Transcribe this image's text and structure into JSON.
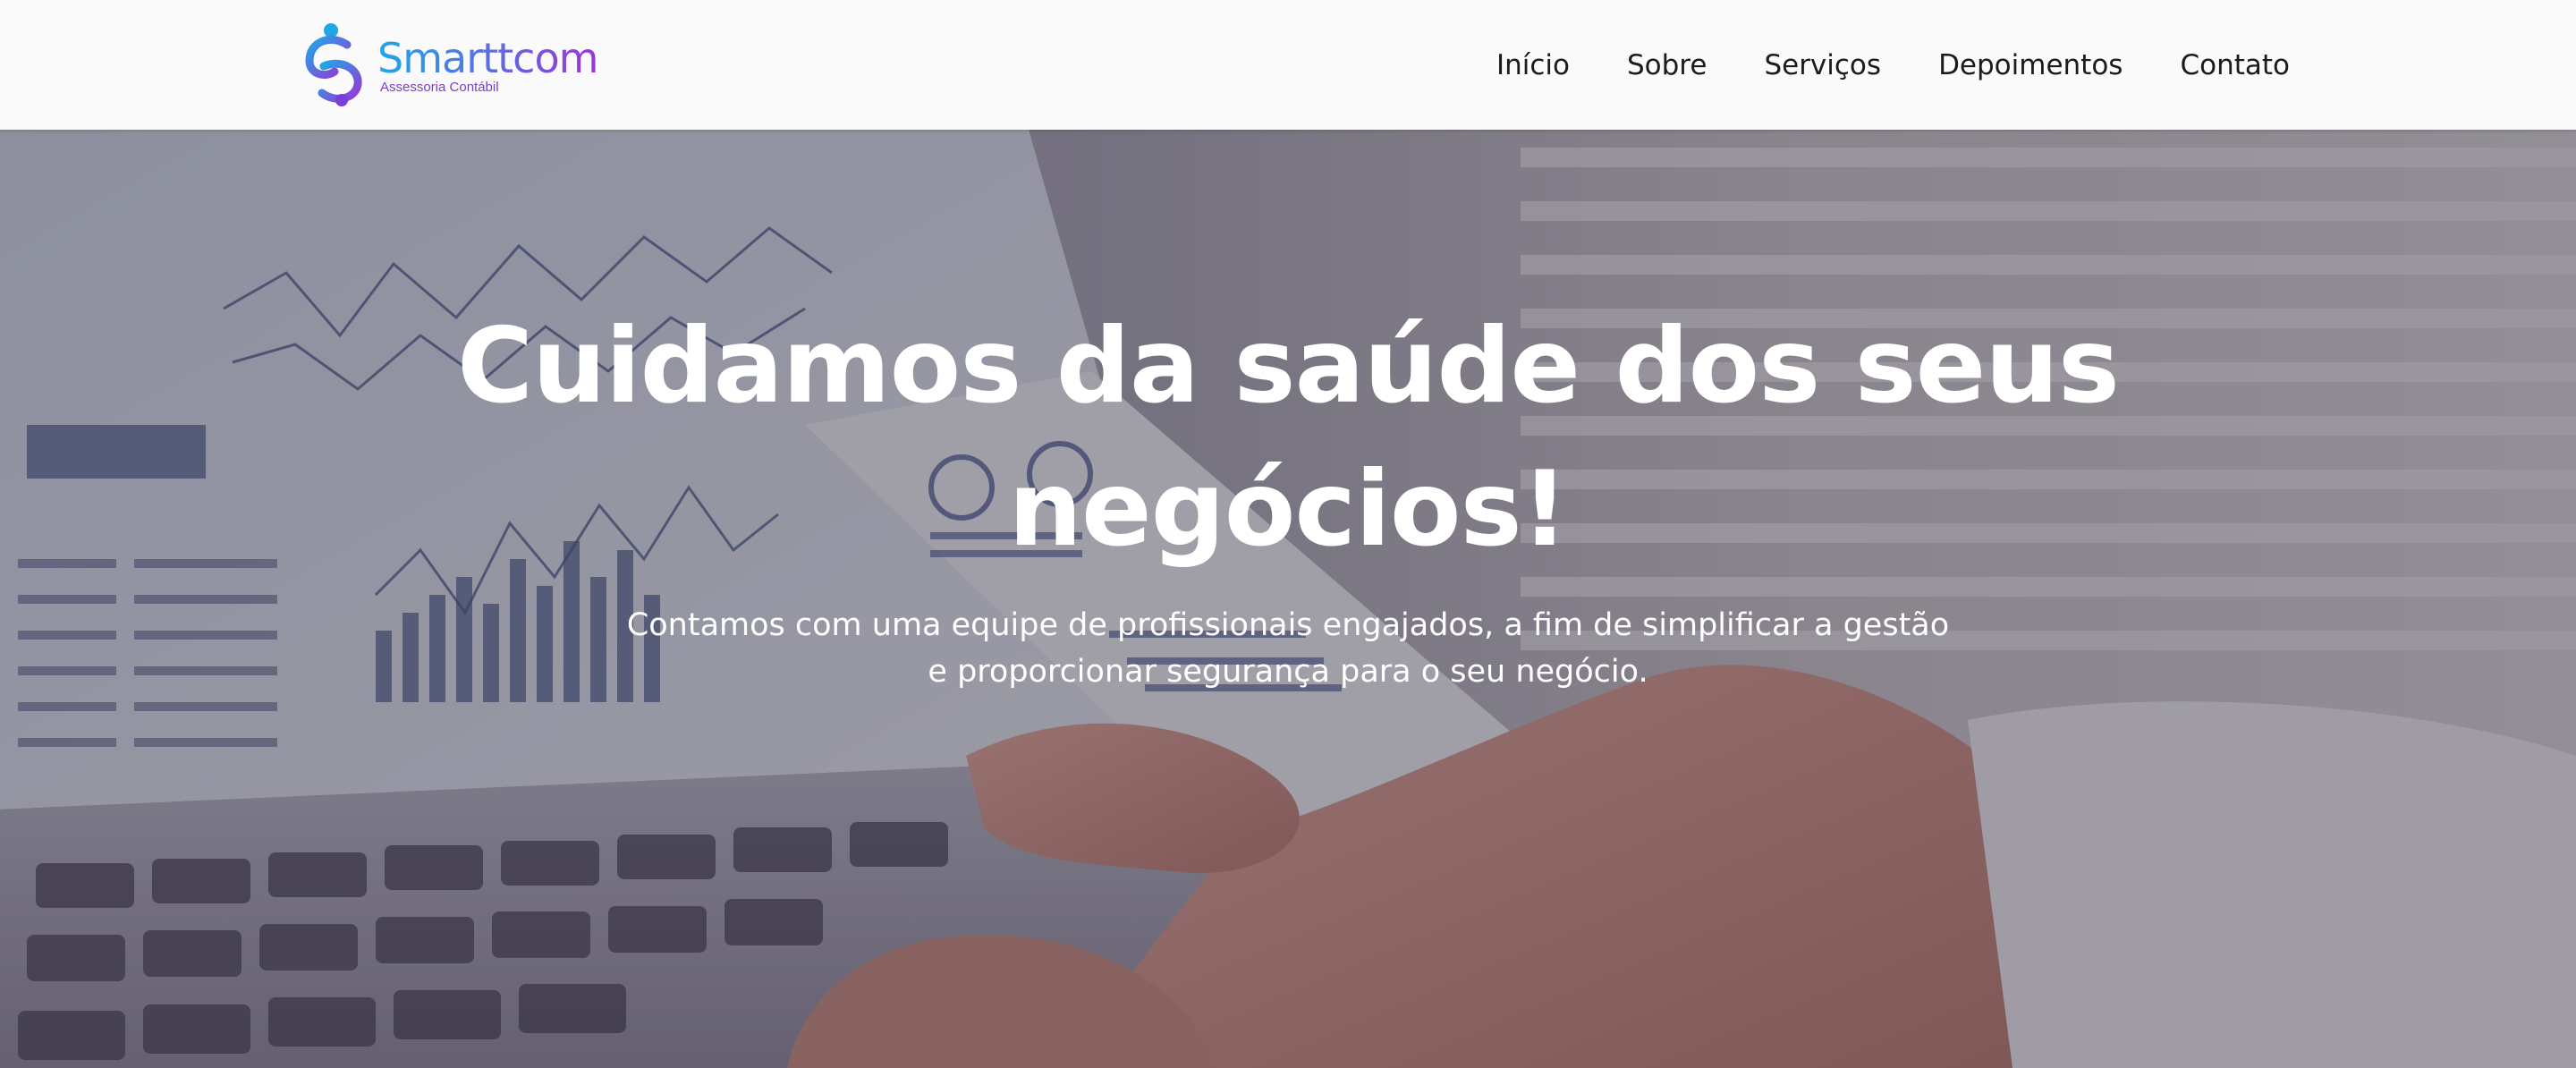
{
  "brand": {
    "name": "Smarttcom",
    "tagline": "Assessoria Contábil",
    "colors": {
      "start": "#1fa7e6",
      "mid": "#5b6fe0",
      "end": "#9b35d6"
    }
  },
  "nav": {
    "items": [
      {
        "label": "Início"
      },
      {
        "label": "Sobre"
      },
      {
        "label": "Serviços"
      },
      {
        "label": "Depoimentos"
      },
      {
        "label": "Contato"
      }
    ]
  },
  "hero": {
    "title": "Cuidamos da saúde dos seus negócios!",
    "subtitle": "Contamos com uma equipe de profissionais engajados, a fim de simplificar a gestão e proporcionar segurança para o seu negócio."
  }
}
